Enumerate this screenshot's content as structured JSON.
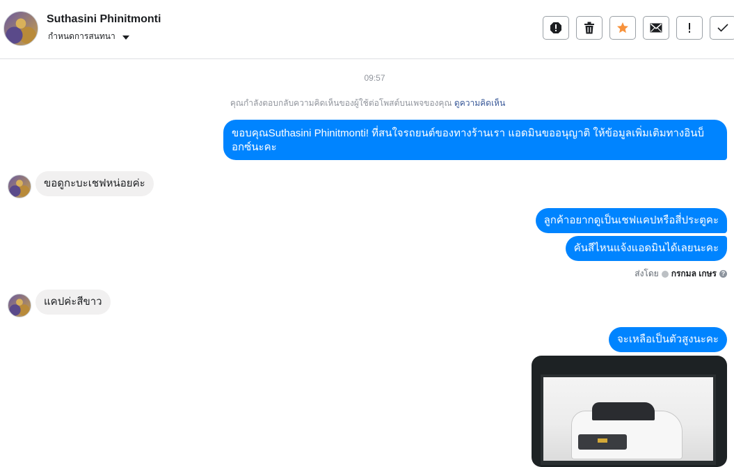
{
  "header": {
    "name": "Suthasini Phinitmonti",
    "subtitle": "กำหนดการสนทนา",
    "actions": [
      {
        "icon": "report-icon"
      },
      {
        "icon": "trash-icon"
      },
      {
        "icon": "star-icon",
        "color": "#f7923b"
      },
      {
        "icon": "mail-icon"
      },
      {
        "icon": "exclamation-icon"
      },
      {
        "icon": "checkmark-icon"
      }
    ]
  },
  "conversation": {
    "time": "09:57",
    "notice_text": "คุณกำลังตอบกลับความคิดเห็นของผู้ใช้ต่อโพสต์บนเพจของคุณ",
    "notice_link": "ดูความคิดเห็น",
    "messages": [
      {
        "direction": "out",
        "text": "ขอบคุณSuthasini Phinitmonti! ที่สนใจรถยนต์ของทางร้านเรา แอดมินขออนุญาติ ให้ข้อมูลเพิ่มเติมทางอินบ็อกซ์นะคะ"
      },
      {
        "direction": "in",
        "text": "ขอดูกะบะเชฟหน่อยค่ะ"
      },
      {
        "direction": "out",
        "text": "ลูกค้าอยากดูเป็นเชฟแคปหรือสี่ประตูคะ"
      },
      {
        "direction": "out",
        "text": "คันสีไหนแจ้งแอดมินได้เลยนะคะ"
      },
      {
        "direction": "in",
        "text": "แคปค่ะสีขาว"
      },
      {
        "direction": "out",
        "text": "จะเหลือเป็นตัวสูงนะคะ"
      }
    ],
    "sent_by_label": "ส่งโดย",
    "sent_by_name": "กรกมล เกษร",
    "colors": {
      "outgoing": "#0084ff",
      "incoming": "#f1f0f0",
      "link": "#385898"
    }
  }
}
